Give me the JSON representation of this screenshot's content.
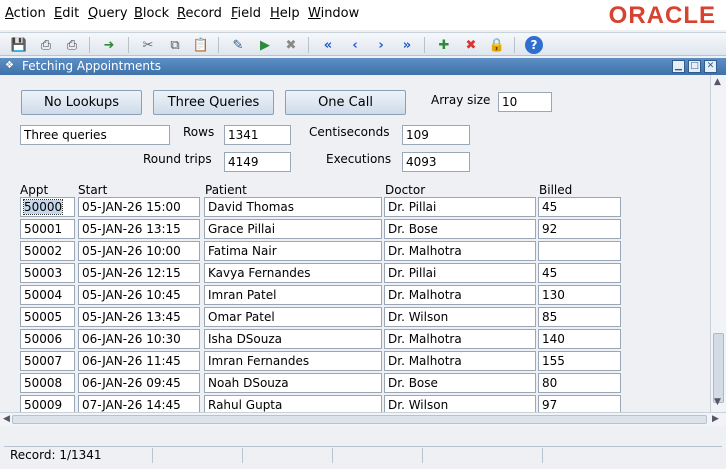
{
  "menu": [
    {
      "label": "Action",
      "key": "A",
      "rest": "ction"
    },
    {
      "label": "Edit",
      "key": "E",
      "rest": "dit"
    },
    {
      "label": "Query",
      "key": "Q",
      "rest": "uery"
    },
    {
      "label": "Block",
      "key": "B",
      "rest": "lock"
    },
    {
      "label": "Record",
      "key": "R",
      "rest": "ecord"
    },
    {
      "label": "Field",
      "key": "F",
      "rest": "ield"
    },
    {
      "label": "Help",
      "key": "H",
      "rest": "elp"
    },
    {
      "label": "Window",
      "key": "W",
      "rest": "indow"
    }
  ],
  "brand": {
    "logo": "ORACLE",
    "color": "#d64331"
  },
  "toolbar_icons": [
    "save-icon",
    "print-icon",
    "print-setup-icon",
    "exit-icon",
    "cut-icon",
    "copy-icon",
    "paste-icon",
    "enter-query-icon",
    "execute-query-icon",
    "cancel-query-icon",
    "first-record-icon",
    "previous-record-icon",
    "next-record-icon",
    "last-record-icon",
    "insert-record-icon",
    "delete-record-icon",
    "lock-record-icon",
    "help-icon"
  ],
  "window": {
    "title": "Fetching Appointments"
  },
  "buttons": {
    "no_lookups": "No Lookups",
    "three_queries": "Three Queries",
    "one_call": "One Call"
  },
  "array_size": {
    "label": "Array size",
    "value": "10"
  },
  "mode": {
    "value": "Three queries"
  },
  "stats": {
    "rows_label": "Rows",
    "rows": "1341",
    "centiseconds_label": "Centiseconds",
    "centiseconds": "109",
    "round_trips_label": "Round trips",
    "round_trips": "4149",
    "executions_label": "Executions",
    "executions": "4093"
  },
  "table": {
    "headers": {
      "appt": "Appt",
      "start": "Start",
      "patient": "Patient",
      "doctor": "Doctor",
      "billed": "Billed"
    },
    "rows": [
      {
        "appt": "50000",
        "start": "05-JAN-26 15:00",
        "patient": "David Thomas",
        "doctor": "Dr. Pillai",
        "billed": "45"
      },
      {
        "appt": "50001",
        "start": "05-JAN-26 13:15",
        "patient": "Grace Pillai",
        "doctor": "Dr. Bose",
        "billed": "92"
      },
      {
        "appt": "50002",
        "start": "05-JAN-26 10:00",
        "patient": "Fatima Nair",
        "doctor": "Dr. Malhotra",
        "billed": ""
      },
      {
        "appt": "50003",
        "start": "05-JAN-26 12:15",
        "patient": "Kavya Fernandes",
        "doctor": "Dr. Pillai",
        "billed": "45"
      },
      {
        "appt": "50004",
        "start": "05-JAN-26 10:45",
        "patient": "Imran Patel",
        "doctor": "Dr. Malhotra",
        "billed": "130"
      },
      {
        "appt": "50005",
        "start": "05-JAN-26 13:45",
        "patient": "Omar Patel",
        "doctor": "Dr. Wilson",
        "billed": "85"
      },
      {
        "appt": "50006",
        "start": "06-JAN-26 10:30",
        "patient": "Isha DSouza",
        "doctor": "Dr. Malhotra",
        "billed": "140"
      },
      {
        "appt": "50007",
        "start": "06-JAN-26 11:45",
        "patient": "Imran Fernandes",
        "doctor": "Dr. Malhotra",
        "billed": "155"
      },
      {
        "appt": "50008",
        "start": "06-JAN-26 09:45",
        "patient": "Noah DSouza",
        "doctor": "Dr. Bose",
        "billed": "80"
      },
      {
        "appt": "50009",
        "start": "07-JAN-26 14:45",
        "patient": "Rahul Gupta",
        "doctor": "Dr. Wilson",
        "billed": "97"
      }
    ]
  },
  "status": {
    "record": "Record: 1/1341"
  }
}
